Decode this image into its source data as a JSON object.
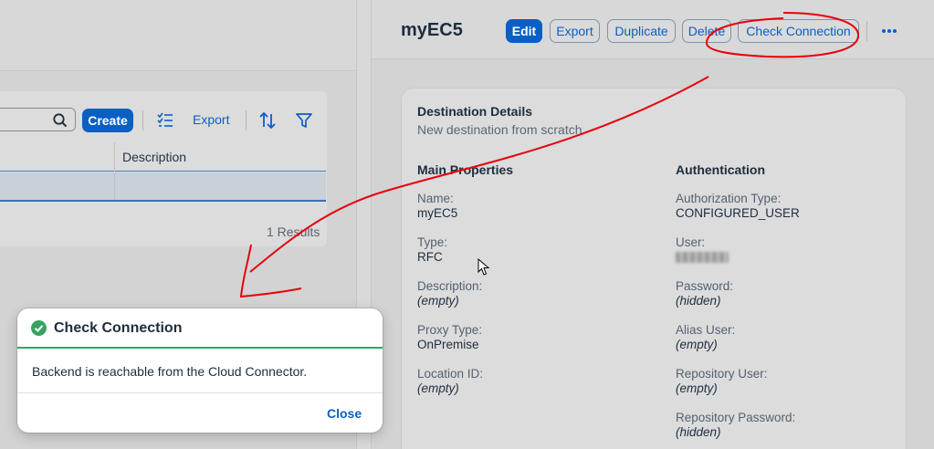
{
  "left": {
    "toolbar": {
      "create_label": "Create",
      "export_label": "Export",
      "icons": [
        "search-icon",
        "select-list-icon",
        "sort-icon",
        "filter-icon"
      ]
    },
    "table": {
      "columns": [
        "Description"
      ],
      "rows": [
        {
          "description": ""
        }
      ],
      "results_text": "1 Results"
    }
  },
  "right": {
    "title": "myEC5",
    "buttons": {
      "edit": "Edit",
      "export": "Export",
      "duplicate": "Duplicate",
      "delete": "Delete",
      "check_connection": "Check Connection"
    },
    "card": {
      "title": "Destination Details",
      "subtitle": "New destination from scratch",
      "main_title": "Main Properties",
      "auth_title": "Authentication",
      "main_props": [
        {
          "label": "Name:",
          "value": "myEC5",
          "empty": false
        },
        {
          "label": "Type:",
          "value": "RFC",
          "empty": false
        },
        {
          "label": "Description:",
          "value": "(empty)",
          "empty": true
        },
        {
          "label": "Proxy Type:",
          "value": "OnPremise",
          "empty": false
        },
        {
          "label": "Location ID:",
          "value": "(empty)",
          "empty": true
        }
      ],
      "auth_props": [
        {
          "label": "Authorization Type:",
          "value": "CONFIGURED_USER",
          "empty": false
        },
        {
          "label": "User:",
          "value": "",
          "blurred": true
        },
        {
          "label": "Password:",
          "value": "(hidden)",
          "empty": true
        },
        {
          "label": "Alias User:",
          "value": "(empty)",
          "empty": true
        },
        {
          "label": "Repository User:",
          "value": "(empty)",
          "empty": true
        },
        {
          "label": "Repository Password:",
          "value": "(hidden)",
          "empty": true
        }
      ]
    }
  },
  "dialog": {
    "title": "Check Connection",
    "message": "Backend is reachable from the Cloud Connector.",
    "close_label": "Close",
    "status": "success"
  },
  "colors": {
    "accent": "#0a5fc4",
    "success": "#36a360",
    "annotation": "#e8000b"
  }
}
